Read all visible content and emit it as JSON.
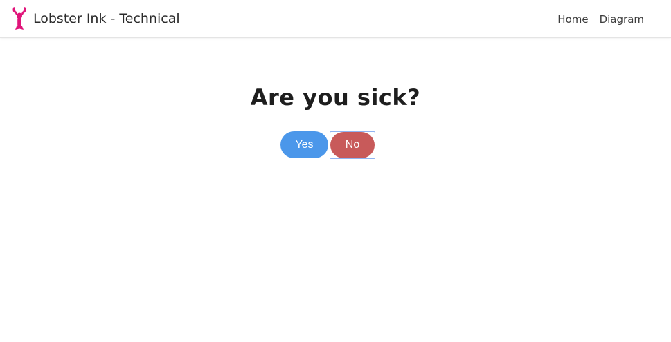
{
  "header": {
    "brand": "Lobster Ink - Technical",
    "nav": [
      {
        "label": "Home"
      },
      {
        "label": "Diagram"
      }
    ]
  },
  "main": {
    "question": "Are you sick?",
    "answers": {
      "yes_label": "Yes",
      "no_label": "No"
    }
  },
  "colors": {
    "brand_logo": "#e0147a",
    "yes_button": "#4b97ea",
    "no_button": "#c85a5a",
    "focus_ring": "#8fb4f2"
  },
  "icons": {
    "brand_logo": "lobster-icon"
  }
}
